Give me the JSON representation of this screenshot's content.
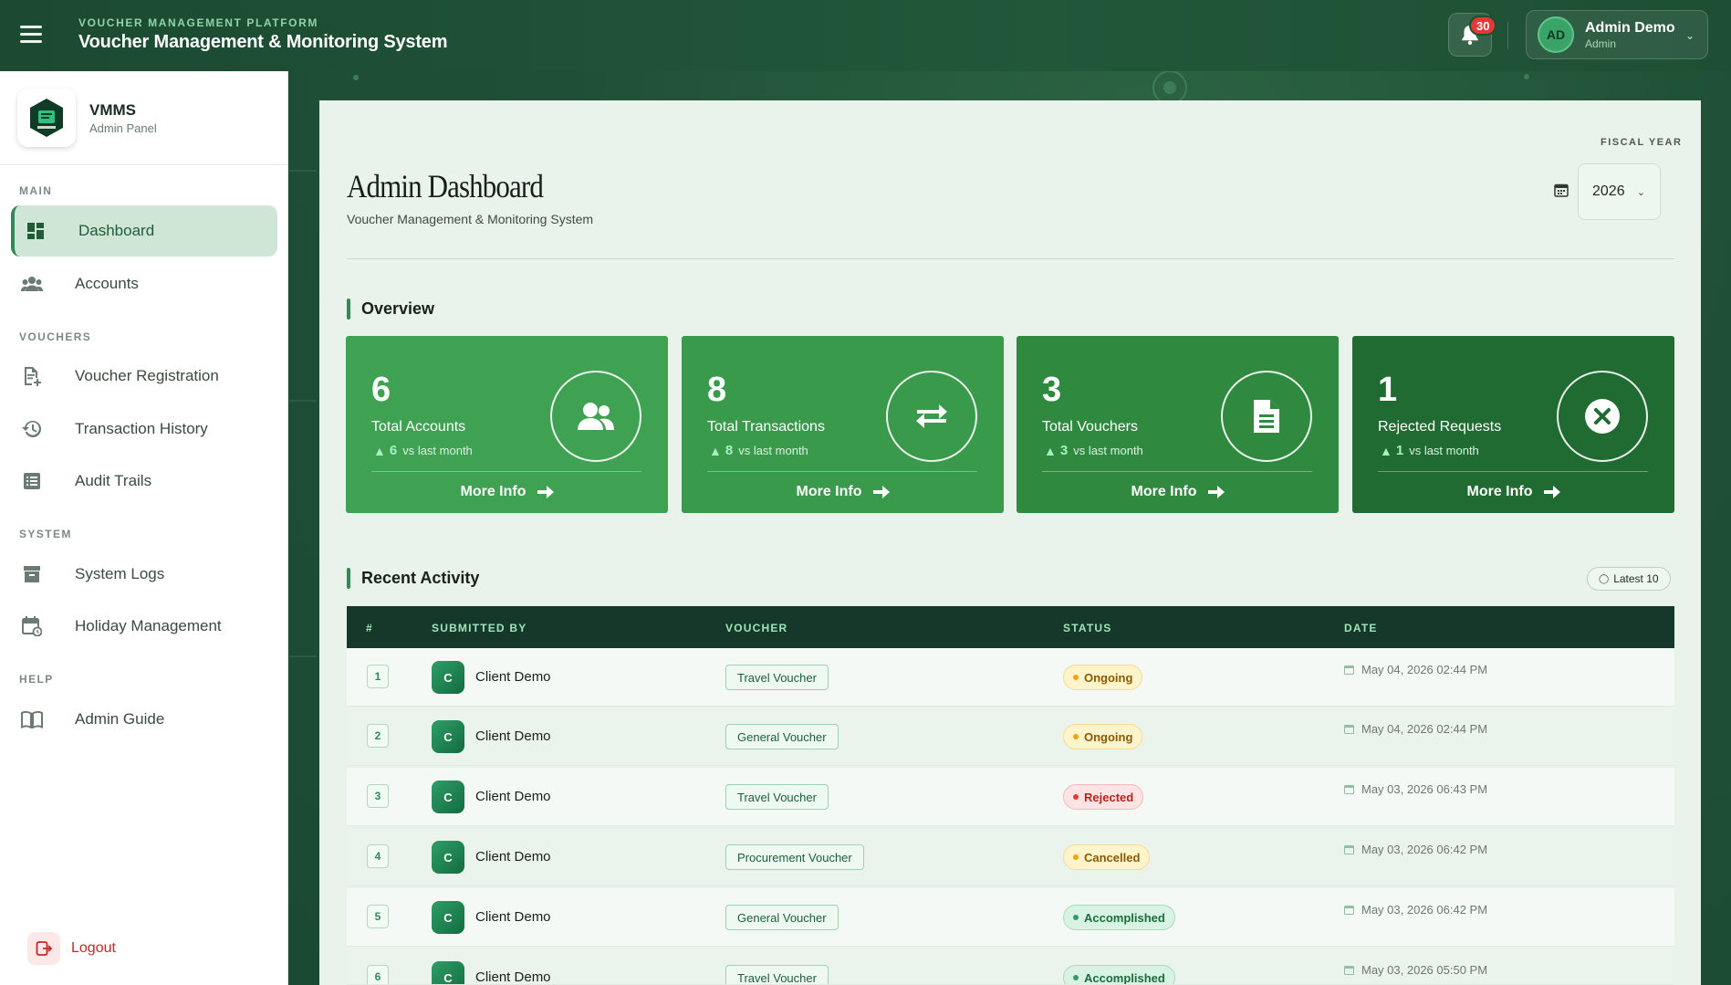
{
  "topbar": {
    "platform_label": "VOUCHER MANAGEMENT PLATFORM",
    "app_title": "Voucher Management & Monitoring System",
    "notification_count": "30",
    "user_initials": "AD",
    "user_name": "Admin Demo",
    "user_role": "Admin"
  },
  "sidebar": {
    "brand_title": "VMMS",
    "brand_sub": "Admin Panel",
    "section_main": "MAIN",
    "section_vouchers": "VOUCHERS",
    "section_system": "SYSTEM",
    "section_help": "HELP",
    "items": [
      {
        "label": "Dashboard",
        "icon": "dashboard-icon"
      },
      {
        "label": "Accounts",
        "icon": "users-icon"
      },
      {
        "label": "Voucher Registration",
        "icon": "file-plus-icon"
      },
      {
        "label": "Transaction History",
        "icon": "history-icon"
      },
      {
        "label": "Audit Trails",
        "icon": "list-icon"
      },
      {
        "label": "System Logs",
        "icon": "archive-icon"
      },
      {
        "label": "Holiday Management",
        "icon": "calendar-icon"
      },
      {
        "label": "Admin Guide",
        "icon": "book-icon"
      }
    ],
    "logout_label": "Logout"
  },
  "header": {
    "title": "Admin Dashboard",
    "subtitle": "Voucher Management & Monitoring System",
    "fiscal_year_label": "FISCAL YEAR",
    "fiscal_year_value": "2026"
  },
  "overview": {
    "heading": "Overview",
    "cards": [
      {
        "value": "6",
        "label": "Total Accounts",
        "trend_num": "6",
        "trend_text": "vs last month",
        "more": "More Info",
        "icon": "users-icon",
        "color": "#3fa152"
      },
      {
        "value": "8",
        "label": "Total Transactions",
        "trend_num": "8",
        "trend_text": "vs last month",
        "more": "More Info",
        "icon": "exchange-icon",
        "color": "#389a4a"
      },
      {
        "value": "3",
        "label": "Total Vouchers",
        "trend_num": "3",
        "trend_text": "vs last month",
        "more": "More Info",
        "icon": "document-icon",
        "color": "#2f8a40"
      },
      {
        "value": "1",
        "label": "Rejected Requests",
        "trend_num": "1",
        "trend_text": "vs last month",
        "more": "More Info",
        "icon": "close-circle-icon",
        "color": "#1f6b31"
      }
    ]
  },
  "activity": {
    "heading": "Recent Activity",
    "latest_label": "Latest 10",
    "columns": [
      "#",
      "SUBMITTED BY",
      "VOUCHER",
      "STATUS",
      "DATE"
    ],
    "rows": [
      {
        "num": "1",
        "initial": "C",
        "name": "Client Demo",
        "voucher": "Travel Voucher",
        "status": "Ongoing",
        "date": "May 04, 2026 02:44 PM"
      },
      {
        "num": "2",
        "initial": "C",
        "name": "Client Demo",
        "voucher": "General Voucher",
        "status": "Ongoing",
        "date": "May 04, 2026 02:44 PM"
      },
      {
        "num": "3",
        "initial": "C",
        "name": "Client Demo",
        "voucher": "Travel Voucher",
        "status": "Rejected",
        "date": "May 03, 2026 06:43 PM"
      },
      {
        "num": "4",
        "initial": "C",
        "name": "Client Demo",
        "voucher": "Procurement Voucher",
        "status": "Cancelled",
        "date": "May 03, 2026 06:42 PM"
      },
      {
        "num": "5",
        "initial": "C",
        "name": "Client Demo",
        "voucher": "General Voucher",
        "status": "Accomplished",
        "date": "May 03, 2026 06:42 PM"
      },
      {
        "num": "6",
        "initial": "C",
        "name": "Client Demo",
        "voucher": "Travel Voucher",
        "status": "Accomplished",
        "date": "May 03, 2026 05:50 PM"
      }
    ]
  }
}
